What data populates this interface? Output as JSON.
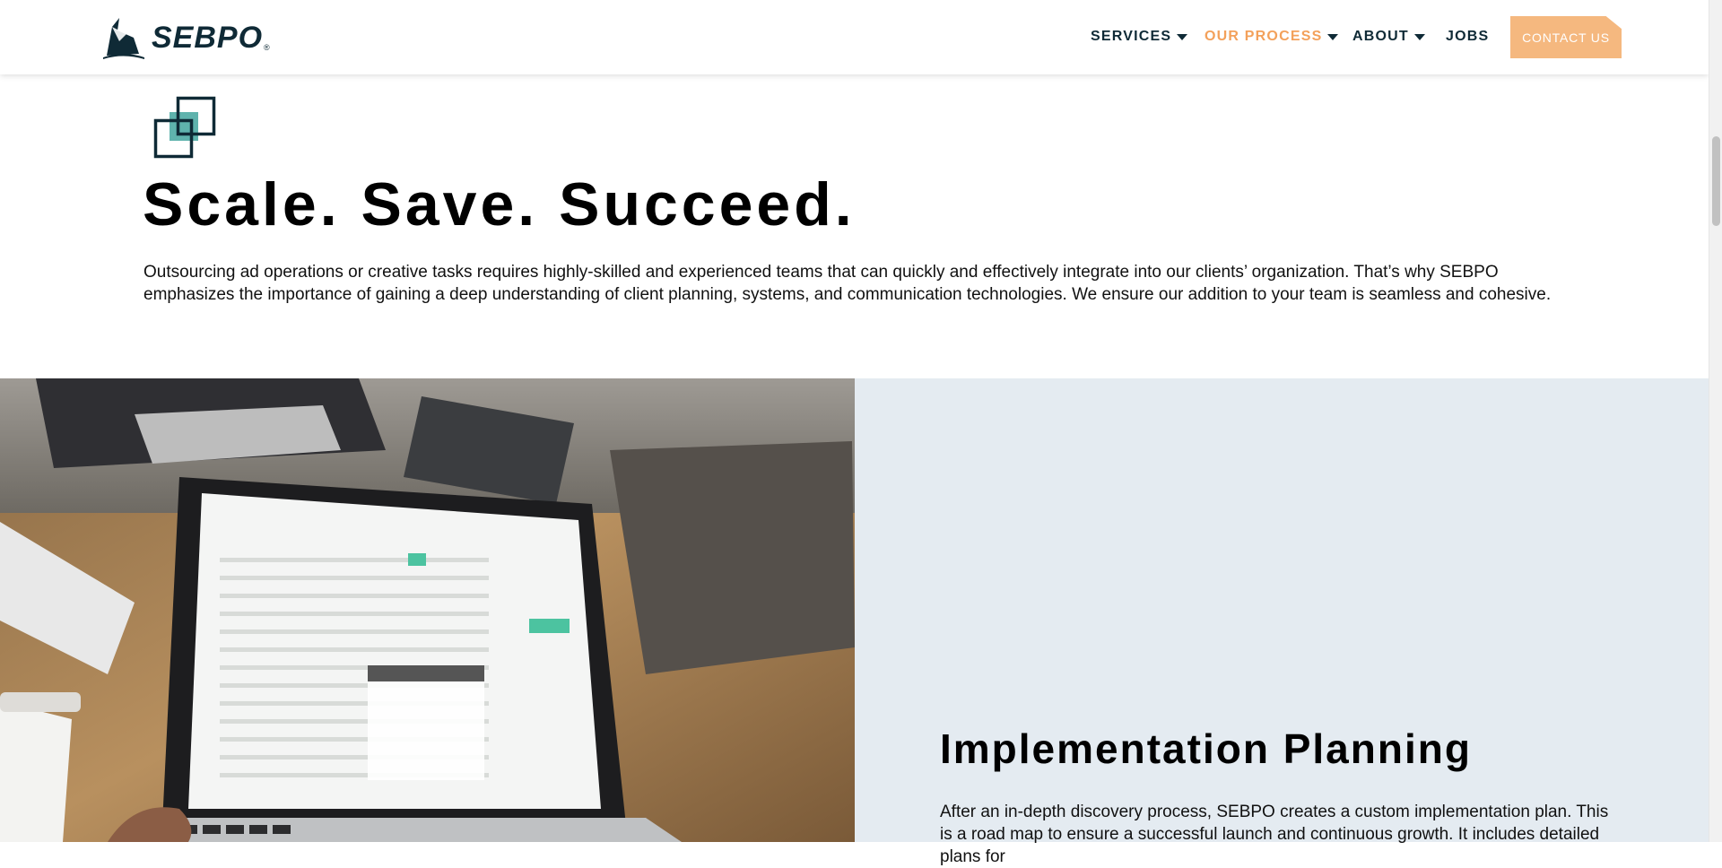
{
  "header": {
    "logo_text": "SEBPO",
    "logo_mark": "®",
    "nav": {
      "services": "SERVICES",
      "our_process": "OUR PROCESS",
      "about": "ABOUT",
      "jobs": "JOBS",
      "contact": "CONTACT US"
    },
    "active_nav": "our_process"
  },
  "intro": {
    "headline": "Scale. Save. Succeed.",
    "body": "Outsourcing ad operations or creative tasks requires highly-skilled and experienced teams that can quickly and effectively integrate into our clients’ organization. That’s why SEBPO emphasizes the importance of gaining a deep understanding of client planning, systems, and communication technologies. We ensure our addition to your team is seamless and cohesive."
  },
  "feature": {
    "image_subject": "laptop on wooden desk showing email inbox",
    "title": "Implementation Planning",
    "body": "After an in-depth discovery process, SEBPO creates a custom implementation plan. This is a road map to ensure a successful launch and continuous growth. It includes detailed plans for"
  },
  "colors": {
    "brand_navy": "#0f2a36",
    "accent_orange": "#f3a15b",
    "contact_button": "#f5b87f",
    "panel_bg": "#e4ebf1",
    "icon_teal": "#5fb3ad"
  }
}
